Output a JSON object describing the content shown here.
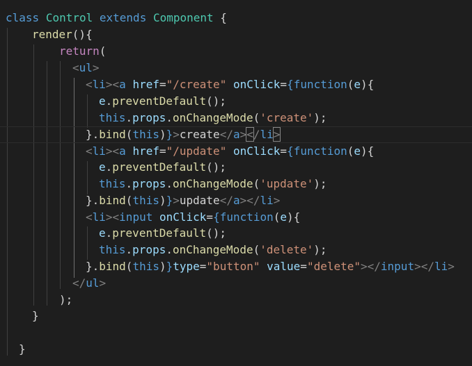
{
  "colors": {
    "background": "#1e1e1e",
    "keyword": "#569cd6",
    "control_keyword": "#c586c0",
    "class_name": "#4ec9b0",
    "function_name": "#dcdcaa",
    "tag_bracket": "#808080",
    "attribute": "#9cdcfe",
    "string": "#ce9178",
    "text": "#d4d4d4"
  },
  "code": {
    "lines": [
      [
        {
          "t": "class",
          "c": "kw"
        },
        {
          "t": " "
        },
        {
          "t": "Control",
          "c": "cls"
        },
        {
          "t": " "
        },
        {
          "t": "extends",
          "c": "kw"
        },
        {
          "t": " "
        },
        {
          "t": "Component",
          "c": "cls"
        },
        {
          "t": " {"
        }
      ],
      [
        {
          "t": "render",
          "c": "fn"
        },
        {
          "t": "(){"
        }
      ],
      [
        {
          "t": "return",
          "c": "ctl"
        },
        {
          "t": "("
        }
      ],
      [
        {
          "t": "<",
          "c": "br"
        },
        {
          "t": "ul",
          "c": "tag"
        },
        {
          "t": ">",
          "c": "br"
        }
      ],
      [
        {
          "t": "<",
          "c": "br"
        },
        {
          "t": "li",
          "c": "tag"
        },
        {
          "t": "><",
          "c": "br"
        },
        {
          "t": "a",
          "c": "tag"
        },
        {
          "t": " "
        },
        {
          "t": "href",
          "c": "attr"
        },
        {
          "t": "="
        },
        {
          "t": "\"/create\"",
          "c": "str"
        },
        {
          "t": " "
        },
        {
          "t": "onClick",
          "c": "attr"
        },
        {
          "t": "="
        },
        {
          "t": "{",
          "c": "kw"
        },
        {
          "t": "function",
          "c": "kw"
        },
        {
          "t": "("
        },
        {
          "t": "e",
          "c": "var"
        },
        {
          "t": "){"
        }
      ],
      [
        {
          "t": "e",
          "c": "var"
        },
        {
          "t": "."
        },
        {
          "t": "preventDefault",
          "c": "fn"
        },
        {
          "t": "();"
        }
      ],
      [
        {
          "t": "this",
          "c": "kw"
        },
        {
          "t": "."
        },
        {
          "t": "props",
          "c": "var"
        },
        {
          "t": "."
        },
        {
          "t": "onChangeMode",
          "c": "fn"
        },
        {
          "t": "("
        },
        {
          "t": "'create'",
          "c": "str"
        },
        {
          "t": ");"
        }
      ],
      [
        {
          "t": "}."
        },
        {
          "t": "bind",
          "c": "fn"
        },
        {
          "t": "("
        },
        {
          "t": "this",
          "c": "kw"
        },
        {
          "t": ")"
        },
        {
          "t": "}",
          "c": "kw"
        },
        {
          "t": ">",
          "c": "br"
        },
        {
          "t": "create"
        },
        {
          "t": "</",
          "c": "br"
        },
        {
          "t": "a",
          "c": "tag"
        },
        {
          "t": ">",
          "c": "br"
        },
        {
          "t": "<",
          "c": "br",
          "m": 1
        },
        {
          "t": "/",
          "c": "br"
        },
        {
          "t": "li",
          "c": "tag"
        },
        {
          "t": ">",
          "c": "br",
          "m": 1
        }
      ],
      [
        {
          "t": "<",
          "c": "br"
        },
        {
          "t": "li",
          "c": "tag"
        },
        {
          "t": "><",
          "c": "br"
        },
        {
          "t": "a",
          "c": "tag"
        },
        {
          "t": " "
        },
        {
          "t": "href",
          "c": "attr"
        },
        {
          "t": "="
        },
        {
          "t": "\"/update\"",
          "c": "str"
        },
        {
          "t": " "
        },
        {
          "t": "onClick",
          "c": "attr"
        },
        {
          "t": "="
        },
        {
          "t": "{",
          "c": "kw"
        },
        {
          "t": "function",
          "c": "kw"
        },
        {
          "t": "("
        },
        {
          "t": "e",
          "c": "var"
        },
        {
          "t": "){"
        }
      ],
      [
        {
          "t": "e",
          "c": "var"
        },
        {
          "t": "."
        },
        {
          "t": "preventDefault",
          "c": "fn"
        },
        {
          "t": "();"
        }
      ],
      [
        {
          "t": "this",
          "c": "kw"
        },
        {
          "t": "."
        },
        {
          "t": "props",
          "c": "var"
        },
        {
          "t": "."
        },
        {
          "t": "onChangeMode",
          "c": "fn"
        },
        {
          "t": "("
        },
        {
          "t": "'update'",
          "c": "str"
        },
        {
          "t": ");"
        }
      ],
      [
        {
          "t": "}."
        },
        {
          "t": "bind",
          "c": "fn"
        },
        {
          "t": "("
        },
        {
          "t": "this",
          "c": "kw"
        },
        {
          "t": ")"
        },
        {
          "t": "}",
          "c": "kw"
        },
        {
          "t": ">",
          "c": "br"
        },
        {
          "t": "update"
        },
        {
          "t": "</",
          "c": "br"
        },
        {
          "t": "a",
          "c": "tag"
        },
        {
          "t": "></",
          "c": "br"
        },
        {
          "t": "li",
          "c": "tag"
        },
        {
          "t": ">",
          "c": "br"
        }
      ],
      [
        {
          "t": "<",
          "c": "br"
        },
        {
          "t": "li",
          "c": "tag"
        },
        {
          "t": "><",
          "c": "br"
        },
        {
          "t": "input",
          "c": "tag"
        },
        {
          "t": " "
        },
        {
          "t": "onClick",
          "c": "attr"
        },
        {
          "t": "="
        },
        {
          "t": "{",
          "c": "kw"
        },
        {
          "t": "function",
          "c": "kw"
        },
        {
          "t": "("
        },
        {
          "t": "e",
          "c": "var"
        },
        {
          "t": "){"
        }
      ],
      [
        {
          "t": "e",
          "c": "var"
        },
        {
          "t": "."
        },
        {
          "t": "preventDefault",
          "c": "fn"
        },
        {
          "t": "();"
        }
      ],
      [
        {
          "t": "this",
          "c": "kw"
        },
        {
          "t": "."
        },
        {
          "t": "props",
          "c": "var"
        },
        {
          "t": "."
        },
        {
          "t": "onChangeMode",
          "c": "fn"
        },
        {
          "t": "("
        },
        {
          "t": "'delete'",
          "c": "str"
        },
        {
          "t": ");"
        }
      ],
      [
        {
          "t": "}."
        },
        {
          "t": "bind",
          "c": "fn"
        },
        {
          "t": "("
        },
        {
          "t": "this",
          "c": "kw"
        },
        {
          "t": ")"
        },
        {
          "t": "}",
          "c": "kw"
        },
        {
          "t": "type",
          "c": "attr"
        },
        {
          "t": "="
        },
        {
          "t": "\"button\"",
          "c": "str"
        },
        {
          "t": " "
        },
        {
          "t": "value",
          "c": "attr"
        },
        {
          "t": "="
        },
        {
          "t": "\"delete\"",
          "c": "str"
        },
        {
          "t": "></",
          "c": "br"
        },
        {
          "t": "input",
          "c": "tag"
        },
        {
          "t": "></",
          "c": "br"
        },
        {
          "t": "li",
          "c": "tag"
        },
        {
          "t": ">",
          "c": "br"
        }
      ],
      [
        {
          "t": "</",
          "c": "br"
        },
        {
          "t": "ul",
          "c": "tag"
        },
        {
          "t": ">",
          "c": "br"
        }
      ],
      [
        {
          "t": ");"
        }
      ],
      [
        {
          "t": "}"
        }
      ],
      [],
      [
        {
          "t": "}"
        }
      ]
    ]
  }
}
